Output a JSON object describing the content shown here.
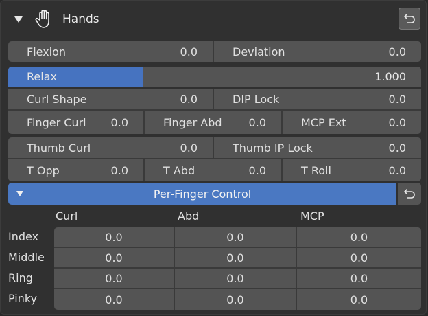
{
  "header": {
    "title": "Hands"
  },
  "row1": [
    {
      "label": "Flexion",
      "value": "0.0"
    },
    {
      "label": "Deviation",
      "value": "0.0"
    }
  ],
  "relax": {
    "label": "Relax",
    "value": "1.000",
    "fraction": 0.327
  },
  "row3": [
    {
      "label": "Curl Shape",
      "value": "0.0"
    },
    {
      "label": "DIP Lock",
      "value": "0.0"
    }
  ],
  "row4": [
    {
      "label": "Finger Curl",
      "value": "0.0"
    },
    {
      "label": "Finger Abd",
      "value": "0.0"
    },
    {
      "label": "MCP Ext",
      "value": "0.0"
    }
  ],
  "row5": [
    {
      "label": "Thumb Curl",
      "value": "0.0"
    },
    {
      "label": "Thumb IP Lock",
      "value": "0.0"
    }
  ],
  "row6": [
    {
      "label": "T Opp",
      "value": "0.0"
    },
    {
      "label": "T Abd",
      "value": "0.0"
    },
    {
      "label": "T Roll",
      "value": "0.0"
    }
  ],
  "per_finger": {
    "label": "Per-Finger Control",
    "columns": [
      "Curl",
      "Abd",
      "MCP"
    ],
    "rows": [
      {
        "name": "Index",
        "values": [
          "0.0",
          "0.0",
          "0.0"
        ]
      },
      {
        "name": "Middle",
        "values": [
          "0.0",
          "0.0",
          "0.0"
        ]
      },
      {
        "name": "Ring",
        "values": [
          "0.0",
          "0.0",
          "0.0"
        ]
      },
      {
        "name": "Pinky",
        "values": [
          "0.0",
          "0.0",
          "0.0"
        ]
      }
    ]
  },
  "colors": {
    "accent": "#4673c0",
    "field": "#545454",
    "panel": "#303030"
  }
}
